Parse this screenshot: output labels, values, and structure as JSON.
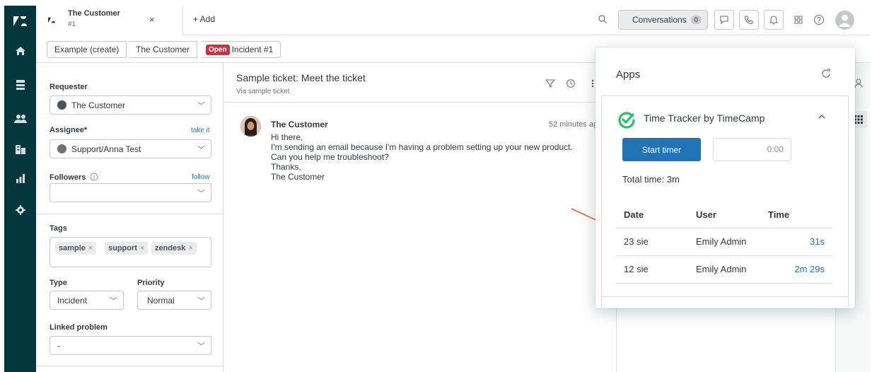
{
  "topbar": {
    "tab_title": "The Customer",
    "tab_subtitle": "#1",
    "tab_close": "×",
    "add_tab_label": "+ Add",
    "conversations_label": "Conversations",
    "conversations_count": "0"
  },
  "breadcrumbs": {
    "item1": "Example (create)",
    "item2": "The Customer",
    "status_badge": "Open",
    "item3": "Incident #1"
  },
  "properties": {
    "requester_label": "Requester",
    "requester_value": "The Customer",
    "assignee_label": "Assignee*",
    "assignee_link": "take it",
    "assignee_value": "Support/Anna Test",
    "followers_label": "Followers",
    "followers_link": "follow",
    "followers_value": "",
    "tags_label": "Tags",
    "tags": [
      "sample",
      "support",
      "zendesk"
    ],
    "tag_remove": "×",
    "type_label": "Type",
    "type_value": "Incident",
    "priority_label": "Priority",
    "priority_value": "Normal",
    "linked_label": "Linked problem",
    "linked_value": "-"
  },
  "ticket": {
    "subject": "Sample ticket: Meet the ticket",
    "via": "Via sample ticket",
    "author": "The Customer",
    "time": "52 minutes ag",
    "body": [
      "Hi there,",
      "I'm sending an email because I'm having a problem setting up your new product.",
      "Can you help me troubleshoot?",
      "Thanks,",
      "The Customer"
    ]
  },
  "apps": {
    "title": "Apps",
    "app_name": "Time Tracker by TimeCamp",
    "start_button": "Start timer",
    "timer_value": "0:00",
    "total_time": "Total time: 3m",
    "columns": [
      "Date",
      "User",
      "Time"
    ],
    "rows": [
      {
        "date": "23 sie",
        "user": "Emily Admin",
        "time": "31s"
      },
      {
        "date": "12 sie",
        "user": "Emily Admin",
        "time": "2m 29s"
      }
    ]
  },
  "colors": {
    "nav_bg": "#03363d",
    "accent_blue": "#1f73b7",
    "open_badge": "#cc3340",
    "timecamp_green": "#25c36b",
    "annotation_arrow": "#e8602c"
  }
}
